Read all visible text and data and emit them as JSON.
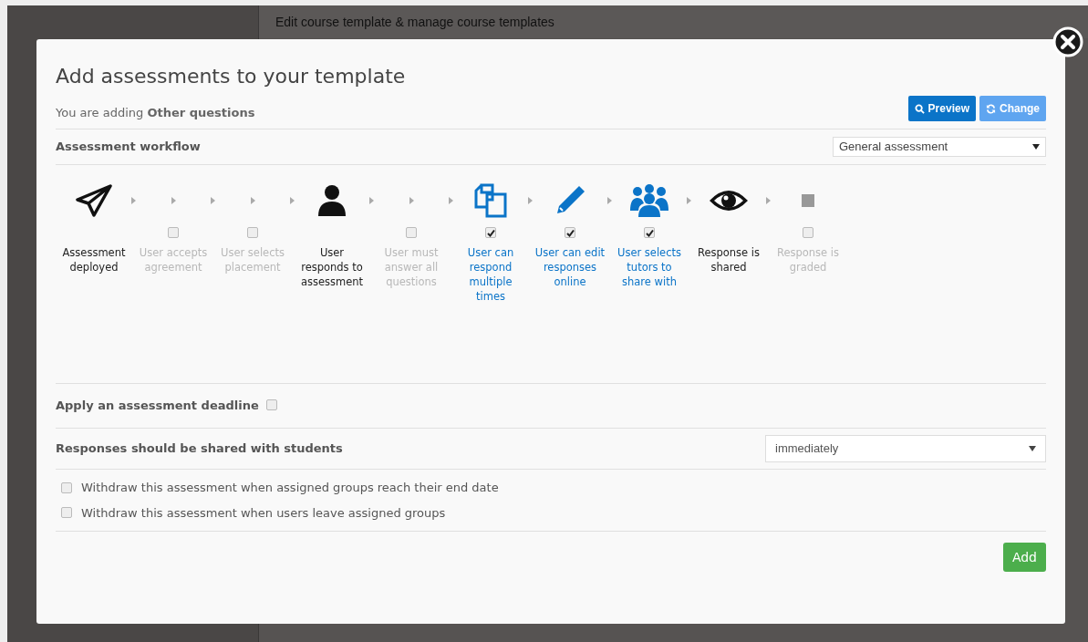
{
  "background": {
    "page_title": "Edit course template & manage course templates"
  },
  "dialog": {
    "title": "Add assessments to your template",
    "subtitle": "You are adding **Other questions**",
    "buttons": [
      {
        "label": "Preview",
        "kind": "primary"
      },
      {
        "label": "Change",
        "kind": "secondary"
      }
    ],
    "workflow_label": "Assessment workflow",
    "workflow_value": "General assessment",
    "steps": [
      {
        "label": "Assessment deployed",
        "kind": "fixed"
      },
      {
        "label": "User accepts agreement",
        "kind": "option",
        "checked": false
      },
      {
        "label": "User selects placement",
        "kind": "option",
        "checked": false
      },
      {
        "label": "User responds to assessment",
        "kind": "fixed"
      },
      {
        "label": "User must answer all questions",
        "kind": "option",
        "checked": false
      },
      {
        "label": "User can respond multiple times",
        "kind": "option",
        "checked": true
      },
      {
        "label": "User can edit responses online",
        "kind": "option",
        "checked": true
      },
      {
        "label": "User selects tutors to share with",
        "kind": "option",
        "checked": true
      },
      {
        "label": "Response is shared",
        "kind": "fixed"
      },
      {
        "label": "Response is graded",
        "kind": "option",
        "checked": false
      }
    ],
    "deadline": {
      "label": "Apply an assessment deadline",
      "checked": false
    },
    "sharing": {
      "label": "Responses should be shared with students",
      "value": "immediately"
    },
    "options": [
      {
        "label": "Withdraw this assessment when assigned groups reach their end date",
        "checked": false
      },
      {
        "label": "Withdraw this assessment when users leave assigned groups",
        "checked": false
      }
    ],
    "add_button": "Add"
  }
}
